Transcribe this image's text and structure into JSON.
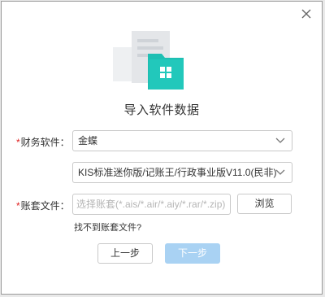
{
  "dialog": {
    "title": "导入软件数据"
  },
  "form": {
    "software_label_star": "*",
    "software_label": "财务软件：",
    "software_value": "金蝶",
    "version_value": "KIS标准迷你版/记账王/行政事业版V11.0(民非)",
    "file_label_star": "*",
    "file_label": "账套文件：",
    "file_placeholder": "选择账套(*.ais/*.air/*.aiy/*.rar/*.zip)",
    "browse_label": "浏览",
    "missing_file_link": "找不到账套文件?"
  },
  "buttons": {
    "prev_label": "上一步",
    "next_label": "下一步"
  },
  "colors": {
    "accent_teal": "#1ebfb3",
    "disabled_blue": "#a9d2f3",
    "required_star": "#e02020"
  },
  "icons": {
    "close": "close-icon",
    "chevron": "chevron-down-icon",
    "illustration": "folder-document-icon"
  }
}
